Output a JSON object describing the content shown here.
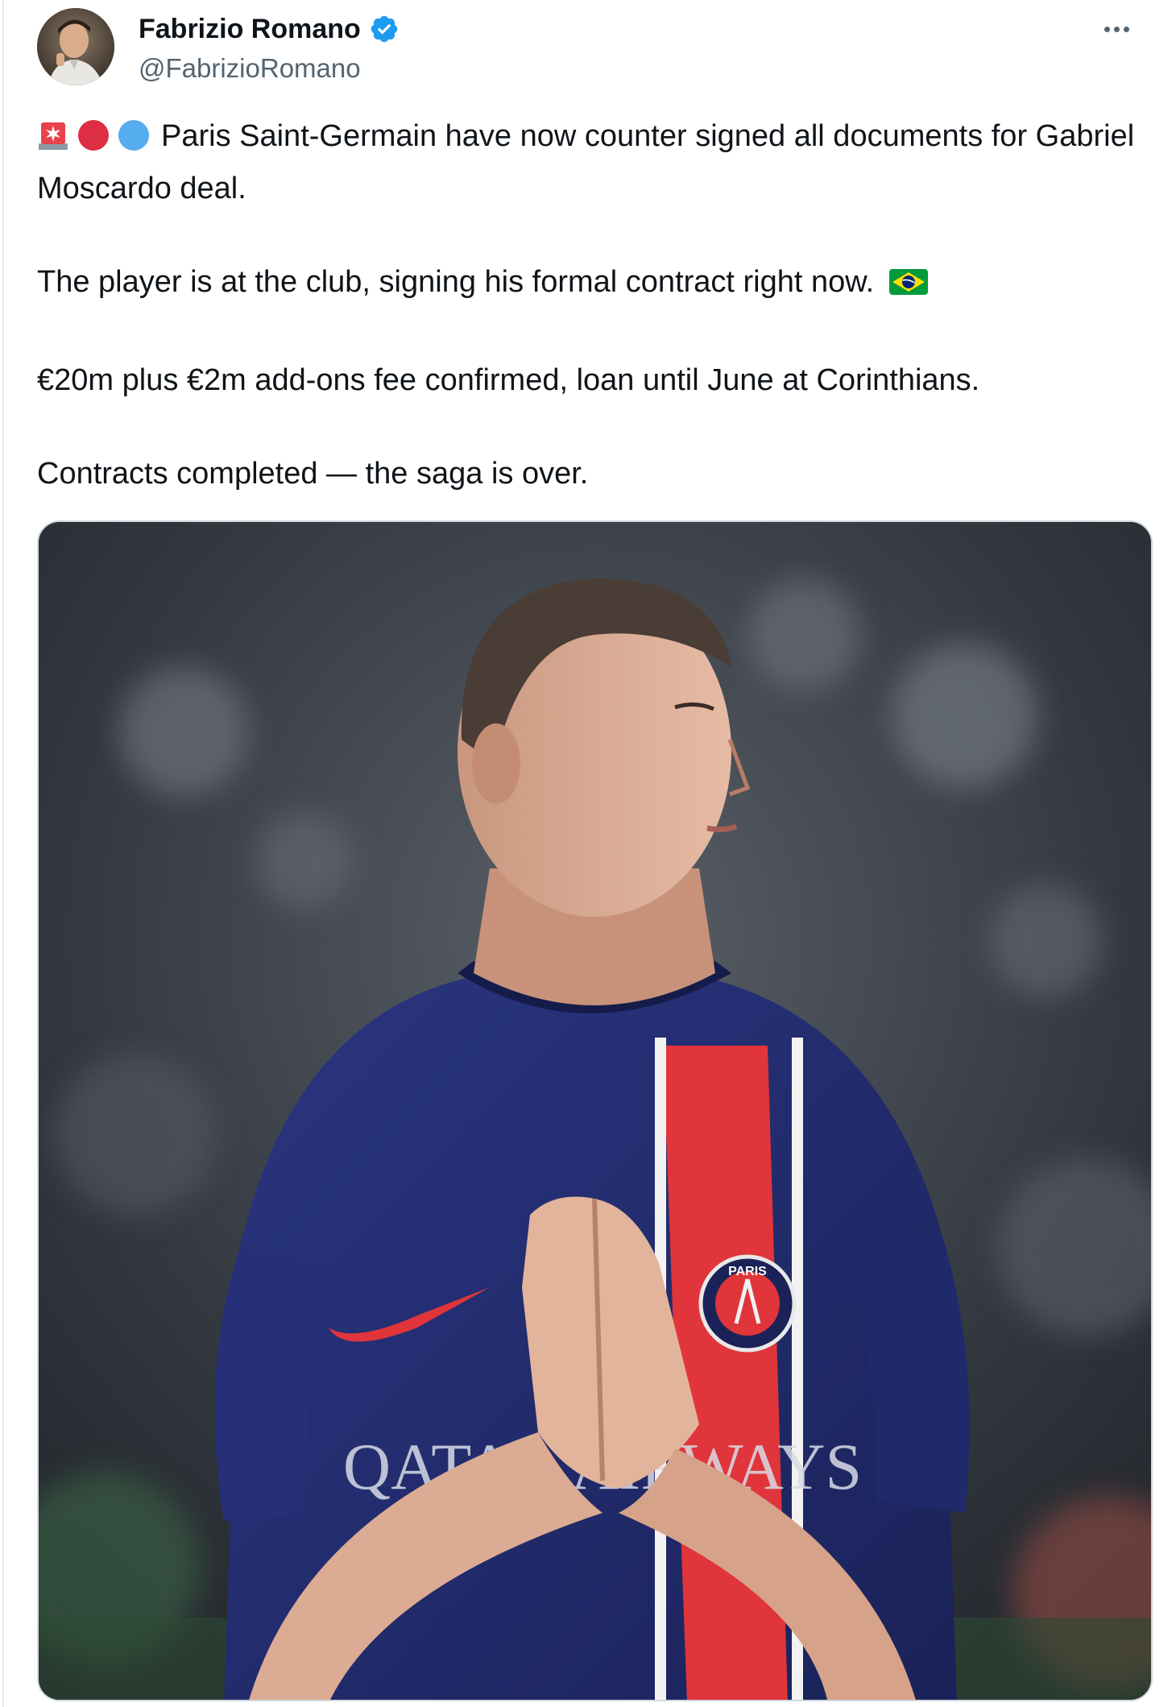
{
  "author": {
    "display_name": "Fabrizio Romano",
    "handle": "@FabrizioRomano",
    "verified": true
  },
  "icons": {
    "verified": "verified-badge-icon",
    "more": "more-options-icon",
    "siren": "police-light-emoji",
    "red_circle": "red-circle-emoji",
    "blue_circle": "blue-circle-emoji",
    "flag": "brazil-flag-emoji"
  },
  "tweet": {
    "line1_text": "Paris Saint-Germain have now counter signed all documents for Gabriel Moscardo deal.",
    "line2_text": "The player is at the club, signing his formal contract right now.",
    "line3_text": "€20m plus €2m add-ons fee confirmed, loan until June at Corinthians.",
    "line4_text": "Contracts completed — the saga is over."
  },
  "media": {
    "shirt_sponsor": "QATAR AIRWAYS",
    "crest_text": "PARIS"
  },
  "colors": {
    "verified_blue": "#1d9bf0",
    "text_primary": "#0f1419",
    "text_secondary": "#536471",
    "psg_navy": "#1f2a6b",
    "psg_red": "#e0353a"
  }
}
